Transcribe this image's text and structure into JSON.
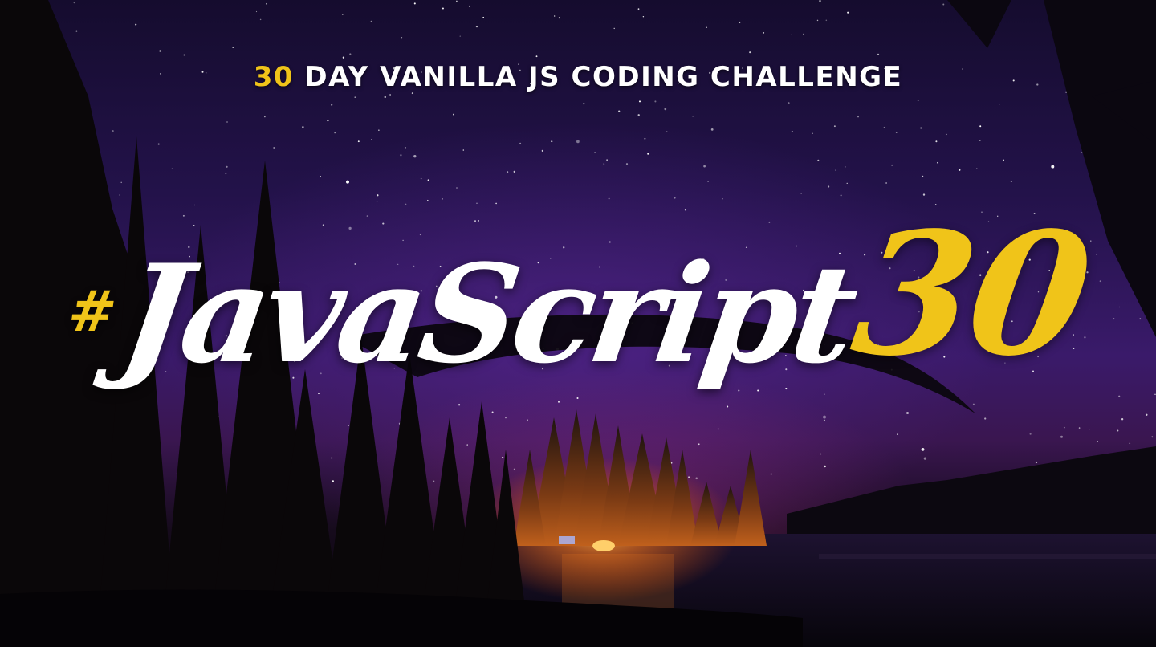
{
  "banner": {
    "subtitle_accent": "30",
    "subtitle_text": " DAY VANILLA JS CODING CHALLENGE",
    "hero_hash": "#",
    "hero_word": "JavaScript",
    "hero_number": "30"
  },
  "colors": {
    "accent": "#f0c419",
    "text": "#ffffff",
    "sky_dark": "#150c2e",
    "sky_mid": "#3a1a6a",
    "campfire": "#ff8a1f"
  }
}
